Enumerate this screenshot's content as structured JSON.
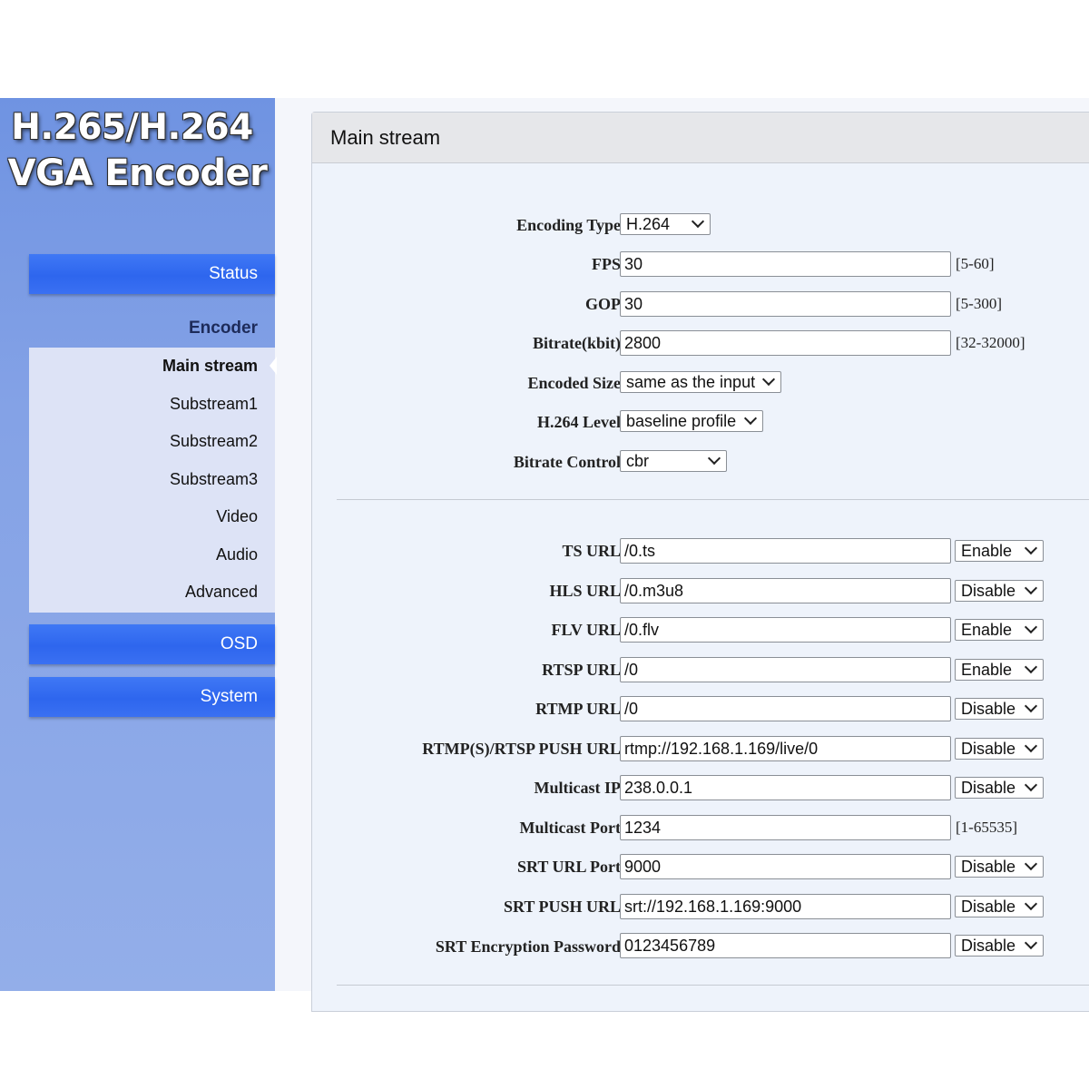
{
  "logo": {
    "line1": "H.265/H.264",
    "line2": "VGA Encoder"
  },
  "nav": {
    "status": "Status",
    "encoder": "Encoder",
    "submenu": [
      "Main stream",
      "Substream1",
      "Substream2",
      "Substream3",
      "Video",
      "Audio",
      "Advanced"
    ],
    "active_submenu": "Main stream",
    "osd": "OSD",
    "system": "System"
  },
  "panel": {
    "title": "Main stream",
    "encoding": {
      "encoding_type": {
        "label": "Encoding Type:",
        "value": "H.264"
      },
      "fps": {
        "label": "FPS:",
        "value": "30",
        "range": "[5-60]"
      },
      "gop": {
        "label": "GOP:",
        "value": "30",
        "range": "[5-300]"
      },
      "bitrate": {
        "label": "Bitrate(kbit):",
        "value": "2800",
        "range": "[32-32000]"
      },
      "encoded_size": {
        "label": "Encoded Size:",
        "value": "same as the input"
      },
      "h264_level": {
        "label": "H.264 Level:",
        "value": "baseline profile"
      },
      "bitrate_control": {
        "label": "Bitrate Control:",
        "value": "cbr"
      }
    },
    "urls": {
      "ts": {
        "label": "TS URL:",
        "value": "/0.ts",
        "state": "Enable"
      },
      "hls": {
        "label": "HLS URL:",
        "value": "/0.m3u8",
        "state": "Disable"
      },
      "flv": {
        "label": "FLV URL:",
        "value": "/0.flv",
        "state": "Enable"
      },
      "rtsp": {
        "label": "RTSP URL:",
        "value": "/0",
        "state": "Enable"
      },
      "rtmp": {
        "label": "RTMP URL:",
        "value": "/0",
        "state": "Disable"
      },
      "push": {
        "label": "RTMP(S)/RTSP PUSH URL:",
        "value": "rtmp://192.168.1.169/live/0",
        "state": "Disable"
      },
      "multicast_ip": {
        "label": "Multicast IP:",
        "value": "238.0.0.1",
        "state": "Disable"
      },
      "multicast_port": {
        "label": "Multicast Port:",
        "value": "1234",
        "range": "[1-65535]"
      },
      "srt_port": {
        "label": "SRT URL Port:",
        "value": "9000",
        "state": "Disable"
      },
      "srt_push": {
        "label": "SRT PUSH URL:",
        "value": "srt://192.168.1.169:9000",
        "state": "Disable"
      },
      "srt_password": {
        "label": "SRT Encryption Password:",
        "value": "0123456789",
        "state": "Disable"
      }
    }
  }
}
